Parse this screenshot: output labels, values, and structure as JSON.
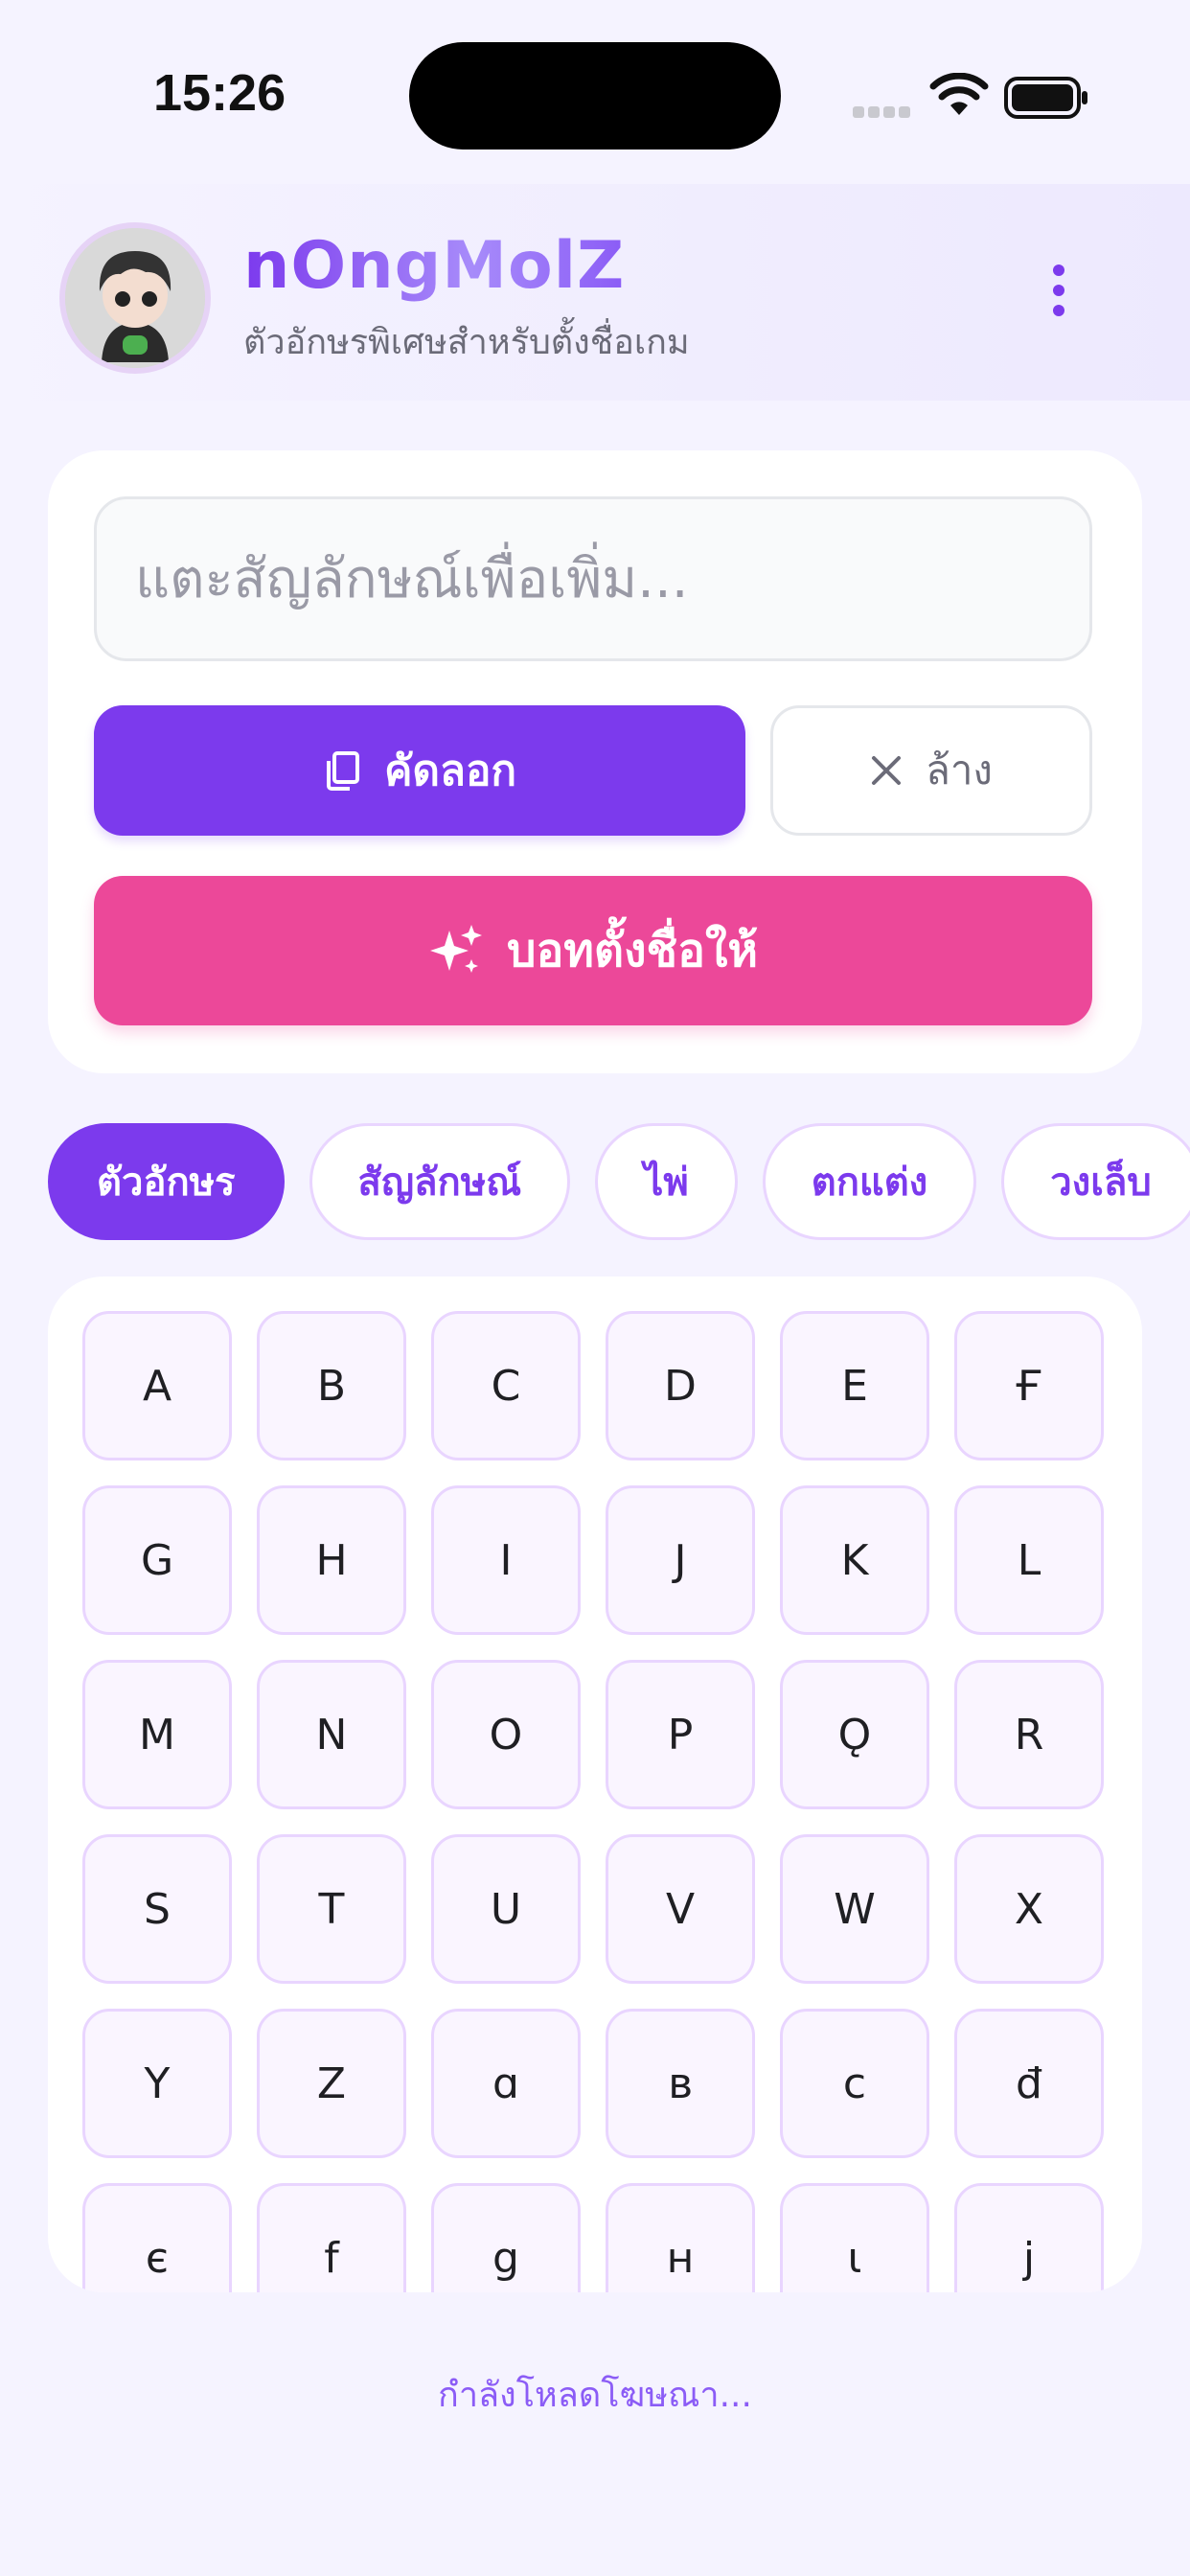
{
  "status_bar": {
    "time": "15:26"
  },
  "header": {
    "title": "nOngMolZ",
    "subtitle": "ตัวอักษรพิเศษสำหรับตั้งชื่อเกม"
  },
  "input": {
    "placeholder": "แตะสัญลักษณ์เพื่อเพิ่ม...",
    "value": ""
  },
  "actions": {
    "copy_label": "คัดลอก",
    "clear_label": "ล้าง",
    "suggest_label": "บอทตั้งชื่อให้"
  },
  "tabs": [
    {
      "label": "ตัวอักษร",
      "active": true
    },
    {
      "label": "สัญลักษณ์",
      "active": false
    },
    {
      "label": "ไพ่",
      "active": false
    },
    {
      "label": "ตกแต่ง",
      "active": false
    },
    {
      "label": "วงเล็บ",
      "active": false
    }
  ],
  "keys": [
    "A",
    "B",
    "C",
    "D",
    "E",
    "Ғ",
    "G",
    "H",
    "I",
    "J",
    "K",
    "L",
    "M",
    "N",
    "O",
    "P",
    "Ǫ",
    "R",
    "S",
    "T",
    "U",
    "V",
    "W",
    "X",
    "Y",
    "Z",
    "ɑ",
    "ʙ",
    "ᴄ",
    "đ",
    "є",
    "f",
    "g",
    "ʜ",
    "ι",
    "j"
  ],
  "ad_loading_text": "กำลังโหลดโฆษณา...",
  "colors": {
    "accent": "#7c3aed",
    "pink": "#ec4899",
    "background": "#f5f3ff",
    "key_border": "#e9d5ff"
  }
}
